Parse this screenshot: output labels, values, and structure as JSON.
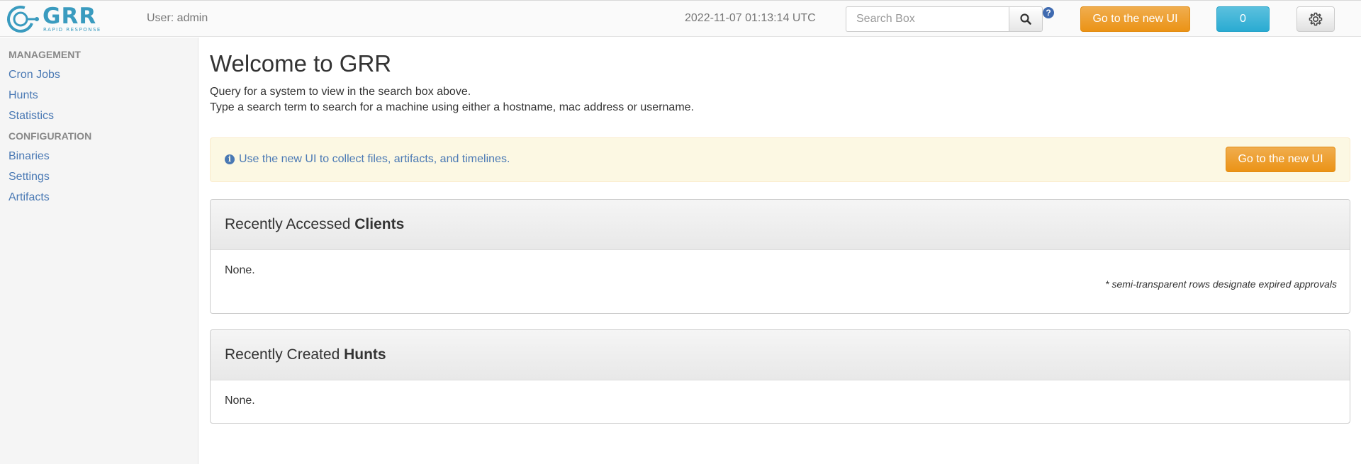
{
  "header": {
    "logo_name": "GRR",
    "logo_sub": "RAPID RESPONSE",
    "user": "User: admin",
    "timestamp": "2022-11-07 01:13:14 UTC",
    "search_placeholder": "Search Box",
    "help_label": "?",
    "new_ui_label": "Go to the new UI",
    "notifications_count": "0"
  },
  "sidebar": {
    "sections": [
      {
        "title": "MANAGEMENT",
        "items": [
          "Cron Jobs",
          "Hunts",
          "Statistics"
        ]
      },
      {
        "title": "CONFIGURATION",
        "items": [
          "Binaries",
          "Settings",
          "Artifacts"
        ]
      }
    ]
  },
  "main": {
    "title": "Welcome to GRR",
    "desc_line1": "Query for a system to view in the search box above.",
    "desc_line2": "Type a search term to search for a machine using either a hostname, mac address or username.",
    "alert_text": "Use the new UI to collect files, artifacts, and timelines.",
    "alert_button": "Go to the new UI",
    "clients_panel": {
      "title_prefix": "Recently Accessed ",
      "title_bold": "Clients",
      "body": "None.",
      "note": "* semi-transparent rows designate expired approvals"
    },
    "hunts_panel": {
      "title_prefix": "Recently Created ",
      "title_bold": "Hunts",
      "body": "None."
    }
  },
  "colors": {
    "brand": "#3a9bbf",
    "link": "#4a79b4",
    "orange": "#eb9316",
    "info": "#5bc0de"
  }
}
